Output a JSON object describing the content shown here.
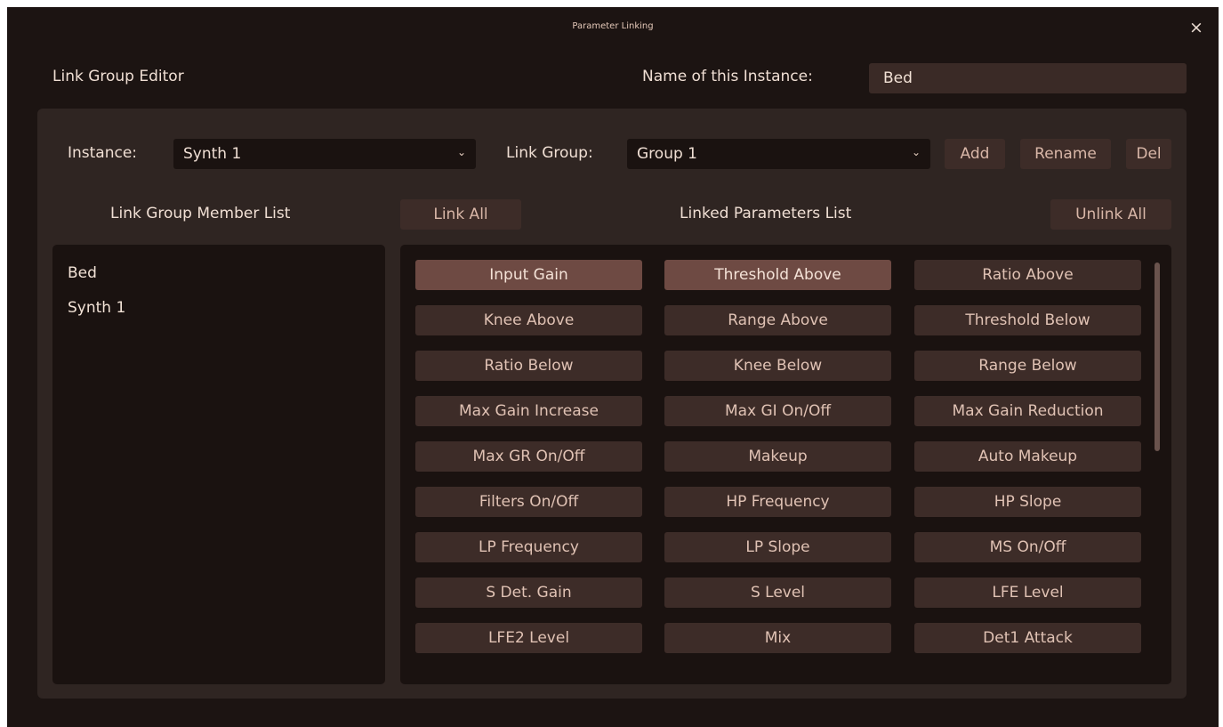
{
  "window": {
    "title": "Parameter Linking",
    "close_label": "×"
  },
  "header": {
    "editor_label": "Link Group Editor",
    "name_label": "Name of this Instance:",
    "name_value": "Bed"
  },
  "controls": {
    "instance_label": "Instance:",
    "instance_value": "Synth 1",
    "link_group_label": "Link Group:",
    "link_group_value": "Group 1",
    "add_label": "Add",
    "rename_label": "Rename",
    "del_label": "Del",
    "member_list_label": "Link Group Member List",
    "link_all_label": "Link All",
    "linked_params_label": "Linked Parameters List",
    "unlink_all_label": "Unlink All"
  },
  "members": [
    "Bed",
    "Synth 1"
  ],
  "parameters": [
    {
      "label": "Input Gain",
      "linked": true
    },
    {
      "label": "Threshold Above",
      "linked": true
    },
    {
      "label": "Ratio Above",
      "linked": false
    },
    {
      "label": "Knee Above",
      "linked": false
    },
    {
      "label": "Range Above",
      "linked": false
    },
    {
      "label": "Threshold Below",
      "linked": false
    },
    {
      "label": "Ratio Below",
      "linked": false
    },
    {
      "label": "Knee Below",
      "linked": false
    },
    {
      "label": "Range Below",
      "linked": false
    },
    {
      "label": "Max Gain Increase",
      "linked": false
    },
    {
      "label": "Max GI On/Off",
      "linked": false
    },
    {
      "label": "Max Gain Reduction",
      "linked": false
    },
    {
      "label": "Max GR On/Off",
      "linked": false
    },
    {
      "label": "Makeup",
      "linked": false
    },
    {
      "label": "Auto Makeup",
      "linked": false
    },
    {
      "label": "Filters On/Off",
      "linked": false
    },
    {
      "label": "HP Frequency",
      "linked": false
    },
    {
      "label": "HP Slope",
      "linked": false
    },
    {
      "label": "LP Frequency",
      "linked": false
    },
    {
      "label": "LP Slope",
      "linked": false
    },
    {
      "label": "MS On/Off",
      "linked": false
    },
    {
      "label": "S Det. Gain",
      "linked": false
    },
    {
      "label": "S Level",
      "linked": false
    },
    {
      "label": "LFE Level",
      "linked": false
    },
    {
      "label": "LFE2 Level",
      "linked": false
    },
    {
      "label": "Mix",
      "linked": false
    },
    {
      "label": "Det1 Attack",
      "linked": false
    }
  ]
}
